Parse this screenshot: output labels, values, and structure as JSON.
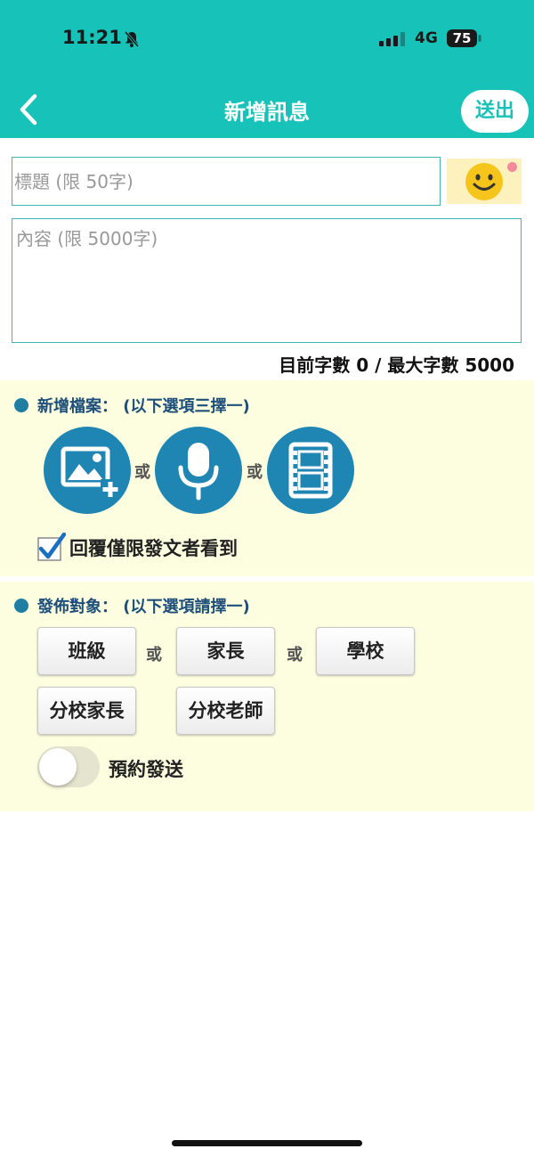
{
  "status_bar": {
    "time": "11:21",
    "network": "4G",
    "battery": "75"
  },
  "nav": {
    "title": "新增訊息",
    "send_label": "送出"
  },
  "form": {
    "title_placeholder": "標題 (限 50字)",
    "content_placeholder": "內容 (限 5000字)",
    "counter": "目前字數 0 / 最大字數 5000"
  },
  "files_section": {
    "title": "新增檔案：  (以下選項三擇一)",
    "options": [
      {
        "icon": "add-image-icon"
      },
      {
        "icon": "microphone-icon"
      },
      {
        "icon": "film-icon"
      }
    ],
    "or_label": "或",
    "reply_checkbox": {
      "label": "回覆僅限發文者看到",
      "checked": true
    }
  },
  "target_section": {
    "title": "發佈對象：  (以下選項請擇一)",
    "or_label": "或",
    "buttons": [
      "班級",
      "家長",
      "學校",
      "分校家長",
      "分校老師"
    ],
    "schedule": {
      "label": "預約發送",
      "enabled": false
    }
  },
  "colors": {
    "header": "#17c2b8",
    "section_bg": "#fdfde0",
    "media_button": "#1f86b3",
    "section_title": "#1d4f7a"
  }
}
